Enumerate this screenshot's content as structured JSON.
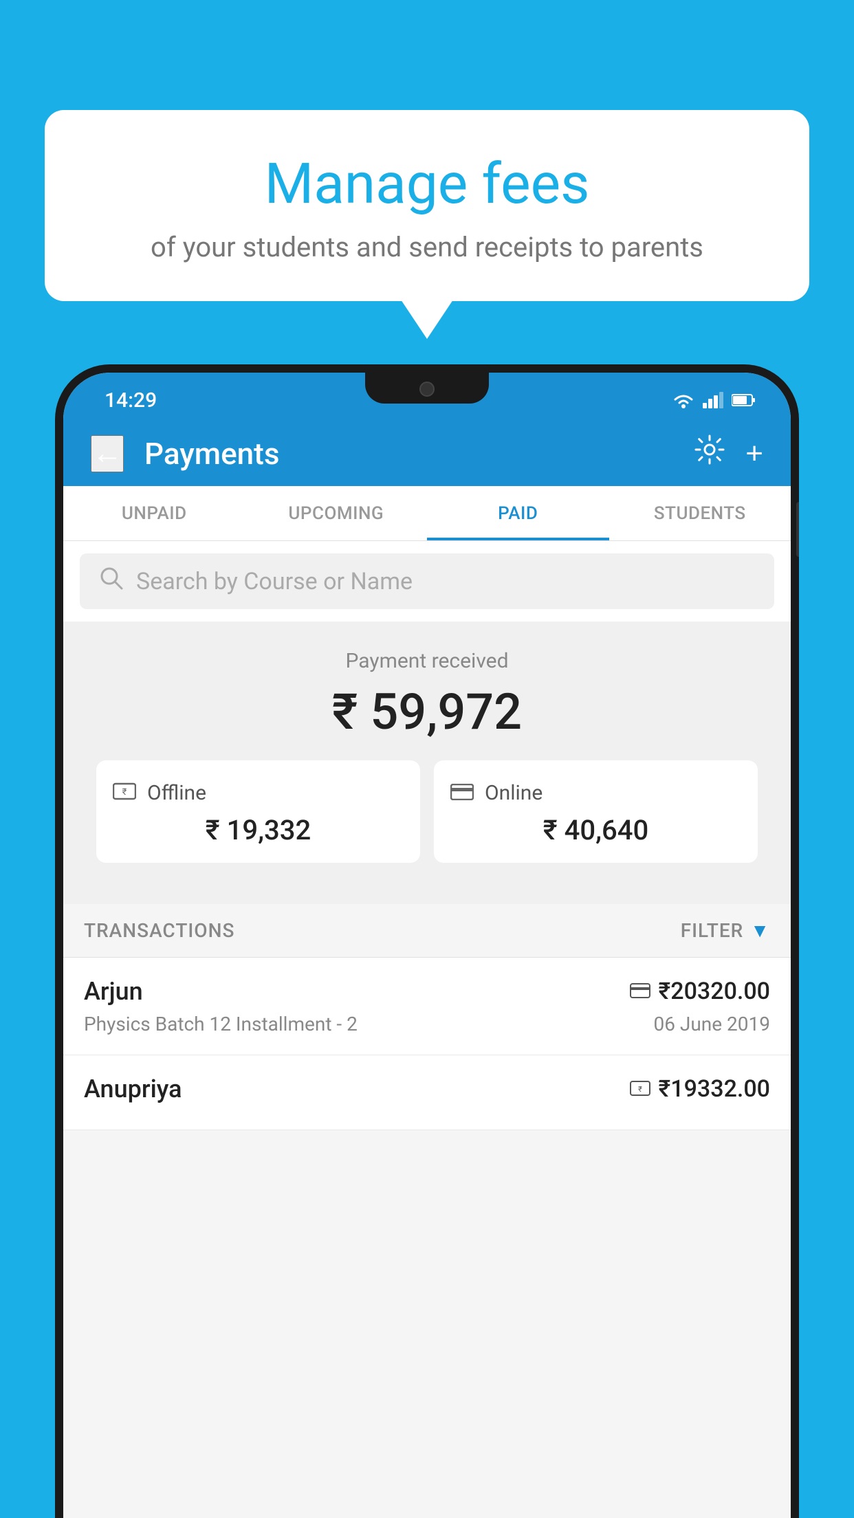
{
  "bubble": {
    "title": "Manage fees",
    "subtitle": "of your students and send receipts to parents"
  },
  "status_bar": {
    "time": "14:29"
  },
  "header": {
    "title": "Payments",
    "back_label": "←",
    "settings_label": "⚙",
    "add_label": "+"
  },
  "tabs": [
    {
      "id": "unpaid",
      "label": "UNPAID",
      "active": false
    },
    {
      "id": "upcoming",
      "label": "UPCOMING",
      "active": false
    },
    {
      "id": "paid",
      "label": "PAID",
      "active": true
    },
    {
      "id": "students",
      "label": "STUDENTS",
      "active": false
    }
  ],
  "search": {
    "placeholder": "Search by Course or Name"
  },
  "payment_received": {
    "label": "Payment received",
    "amount": "₹ 59,972"
  },
  "payment_cards": [
    {
      "id": "offline",
      "label": "Offline",
      "amount": "₹ 19,332",
      "icon": "rupee-card"
    },
    {
      "id": "online",
      "label": "Online",
      "amount": "₹ 40,640",
      "icon": "credit-card"
    }
  ],
  "transactions_header": {
    "label": "TRANSACTIONS",
    "filter_label": "FILTER"
  },
  "transactions": [
    {
      "name": "Arjun",
      "course": "Physics Batch 12 Installment - 2",
      "amount": "₹20320.00",
      "date": "06 June 2019",
      "payment_type": "online"
    },
    {
      "name": "Anupriya",
      "course": "",
      "amount": "₹19332.00",
      "date": "",
      "payment_type": "offline"
    }
  ],
  "colors": {
    "primary": "#1A8FD1",
    "background": "#1AAFE6",
    "white": "#ffffff",
    "light_gray": "#f0f0f0"
  }
}
